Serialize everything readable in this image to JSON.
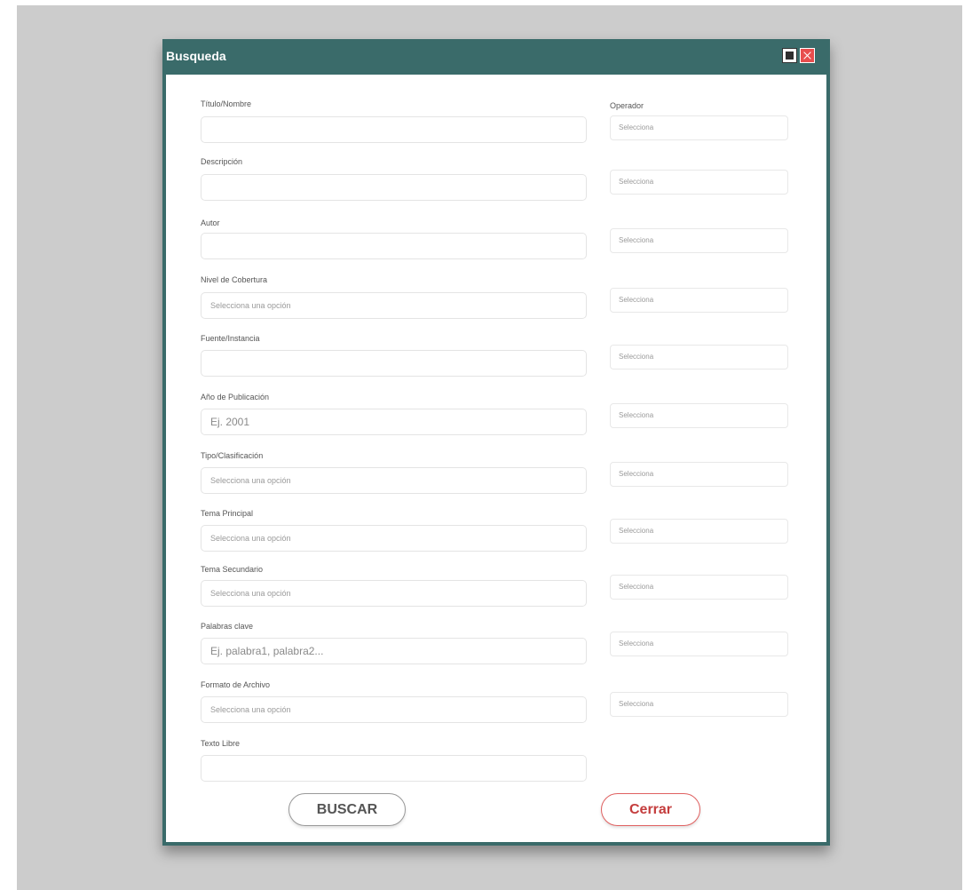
{
  "window": {
    "title": "Busqueda"
  },
  "operator_header": "Operador",
  "fields": [
    {
      "label": "Título/Nombre",
      "value": ""
    },
    {
      "label": "Descripción",
      "value": ""
    },
    {
      "label": "Autor",
      "value": ""
    },
    {
      "label": "Nivel de Cobertura",
      "value": "Selecciona una opción"
    },
    {
      "label": "Fuente/Instancia",
      "value": ""
    },
    {
      "label": "Año de Publicación",
      "value": "Ej. 2001"
    },
    {
      "label": "Tipo/Clasificación",
      "value": "Selecciona una opción"
    },
    {
      "label": "Tema Principal",
      "value": "Selecciona una opción"
    },
    {
      "label": "Tema Secundario",
      "value": "Selecciona una opción"
    },
    {
      "label": "Palabras clave",
      "value": "Ej. palabra1, palabra2..."
    },
    {
      "label": "Formato de Archivo",
      "value": "Selecciona una opción"
    },
    {
      "label": "Texto Libre",
      "value": ""
    }
  ],
  "operators": [
    "Selecciona",
    "Selecciona",
    "Selecciona",
    "Selecciona",
    "Selecciona",
    "Selecciona",
    "Selecciona",
    "Selecciona",
    "Selecciona",
    "Selecciona",
    "Selecciona"
  ],
  "buttons": {
    "search": "BUSCAR",
    "close": "Cerrar"
  },
  "colors": {
    "titlebar": "#3a6b6a",
    "close_button_text": "#c43d3d",
    "backdrop": "#cccccc"
  }
}
